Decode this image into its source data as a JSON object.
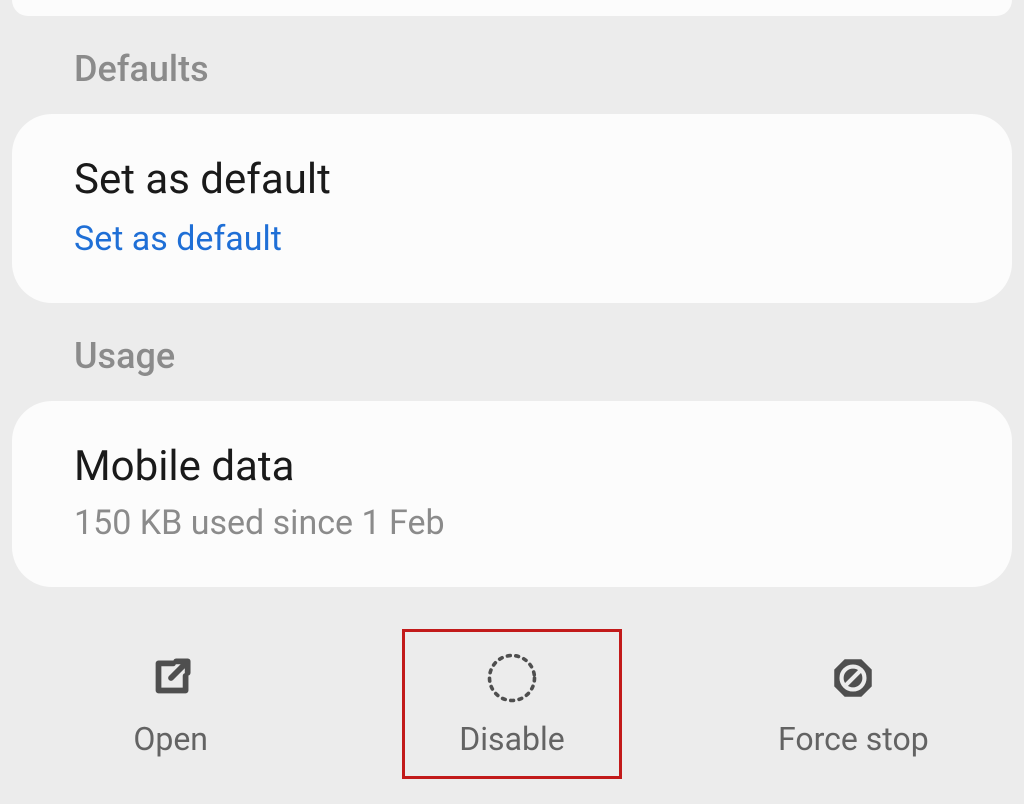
{
  "sections": {
    "defaults_label": "Defaults",
    "usage_label": "Usage"
  },
  "defaults_row": {
    "title": "Set as default",
    "link": "Set as default"
  },
  "usage_row": {
    "title": "Mobile data",
    "subtitle": "150 KB used since 1 Feb"
  },
  "actions": {
    "open": "Open",
    "disable": "Disable",
    "force_stop": "Force stop"
  }
}
